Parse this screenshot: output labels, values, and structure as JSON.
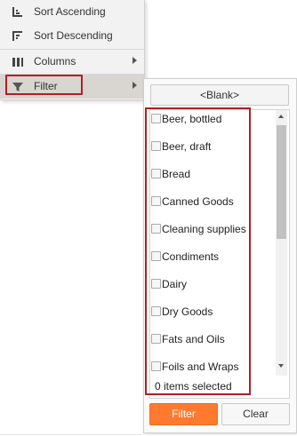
{
  "menu": {
    "items": [
      {
        "label": "Sort Ascending",
        "icon": "sort-ascending-icon"
      },
      {
        "label": "Sort Descending",
        "icon": "sort-descending-icon"
      },
      {
        "label": "Columns",
        "icon": "columns-icon"
      },
      {
        "label": "Filter",
        "icon": "filter-icon"
      }
    ]
  },
  "filter": {
    "blank_label": "<Blank>",
    "options": [
      "Beer, bottled",
      "Beer, draft",
      "Bread",
      "Canned Goods",
      "Cleaning supplies",
      "Condiments",
      "Dairy",
      "Dry Goods",
      "Fats and Oils",
      "Foils and Wraps"
    ],
    "selected_count_text": "0 items selected",
    "filter_label": "Filter",
    "clear_label": "Clear"
  },
  "colors": {
    "accent": "#ff7a2e",
    "highlight_border": "#b21f24"
  }
}
